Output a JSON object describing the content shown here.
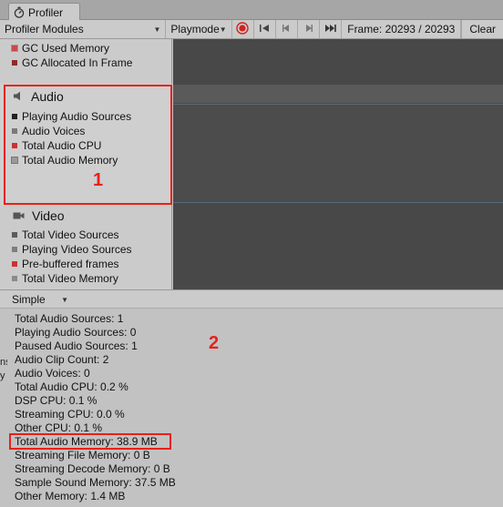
{
  "tab": {
    "title": "Profiler",
    "icon": "profiler-icon"
  },
  "toolbar": {
    "modules_label": "Profiler Modules",
    "playmode_label": "Playmode",
    "frame_text": "Frame: 20293 / 20293",
    "clear_label": "Clear"
  },
  "modules": {
    "memory_items": [
      {
        "label": "GC Used Memory",
        "color": "#c84b4b"
      },
      {
        "label": "GC Allocated In Frame",
        "color": "#8c2b2b"
      }
    ],
    "audio": {
      "title": "Audio",
      "icon": "speaker-icon",
      "items": [
        {
          "label": "Playing Audio Sources",
          "color": "#222222"
        },
        {
          "label": "Audio Voices",
          "color": "#7a7a7a"
        },
        {
          "label": "Total Audio CPU",
          "color": "#cc3333"
        },
        {
          "label": "Total Audio Memory",
          "color": "#9a9a9a"
        }
      ]
    },
    "video": {
      "title": "Video",
      "icon": "video-camera-icon",
      "items": [
        {
          "label": "Total Video Sources",
          "color": "#5c5c5c"
        },
        {
          "label": "Playing Video Sources",
          "color": "#7e7e7e"
        },
        {
          "label": "Pre-buffered frames",
          "color": "#cc3333"
        },
        {
          "label": "Total Video Memory",
          "color": "#8a8a8a"
        }
      ]
    }
  },
  "annotations": {
    "box1_number": "1",
    "box2_number": "2"
  },
  "details": {
    "view_mode": "Simple",
    "stats": [
      "Total Audio Sources: 1",
      "Playing Audio Sources: 0",
      "Paused Audio Sources: 1",
      "Audio Clip Count: 2",
      "Audio Voices: 0",
      "Total Audio CPU: 0.2 %",
      "DSP CPU: 0.1 %",
      "Streaming CPU: 0.0 %",
      "Other CPU: 0.1 %",
      "Total Audio Memory: 38.9 MB",
      "Streaming File Memory: 0 B",
      "Streaming Decode Memory: 0 B",
      "Sample Sound Memory: 37.5 MB",
      "Other Memory: 1.4 MB"
    ],
    "left_edge_fragments": [
      "ns",
      "y"
    ]
  }
}
